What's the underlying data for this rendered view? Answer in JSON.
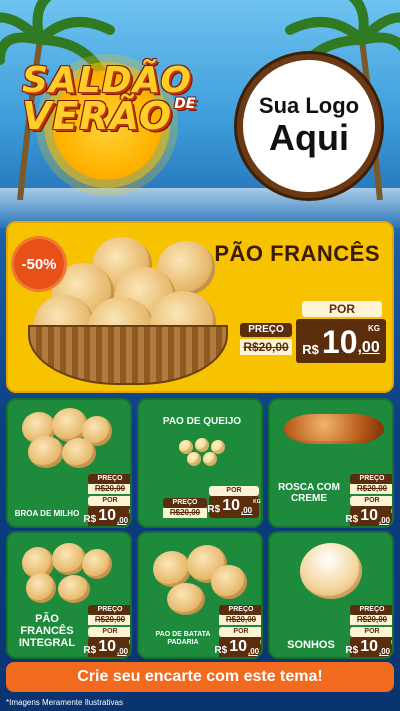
{
  "header": {
    "title_line1": "SALDÃO",
    "title_line2": "VERÃO",
    "title_de": "DE",
    "logo_line1": "Sua Logo",
    "logo_line2": "Aqui"
  },
  "featured": {
    "discount": "-50%",
    "name": "PÃO FRANCÊS",
    "por_label": "POR",
    "preco_label": "PREÇO",
    "old_price": "R$20,00",
    "currency": "R$",
    "price_int": "10",
    "price_dec": ",00",
    "unit": "KG"
  },
  "products": [
    {
      "name": "BROA DE MILHO",
      "preco_label": "PREÇO",
      "old_price": "R$20,00",
      "por_label": "POR",
      "currency": "R$",
      "price_int": "10",
      "price_dec": ",00",
      "unit": "KG"
    },
    {
      "name": "PAO DE QUEIJO",
      "preco_label": "PREÇO",
      "old_price": "R$20,00",
      "por_label": "POR",
      "currency": "R$",
      "price_int": "10",
      "price_dec": ",00",
      "unit": "KG"
    },
    {
      "name": "ROSCA COM CREME",
      "preco_label": "PREÇO",
      "old_price": "R$20,00",
      "por_label": "POR",
      "currency": "R$",
      "price_int": "10",
      "price_dec": ",00",
      "unit": "KG"
    },
    {
      "name": "PÃO FRANCÊS INTEGRAL",
      "preco_label": "PREÇO",
      "old_price": "R$20,00",
      "por_label": "POR",
      "currency": "R$",
      "price_int": "10",
      "price_dec": ",00",
      "unit": "KG"
    },
    {
      "name": "PAO DE BATATA PADARIA",
      "preco_label": "PREÇO",
      "old_price": "R$20,00",
      "por_label": "POR",
      "currency": "R$",
      "price_int": "10",
      "price_dec": ",00",
      "unit": "KG"
    },
    {
      "name": "SONHOS",
      "preco_label": "PREÇO",
      "old_price": "R$20,00",
      "por_label": "POR",
      "currency": "R$",
      "price_int": "10",
      "price_dec": ",00",
      "unit": "KG"
    }
  ],
  "cta": "Crie seu encarte com este tema!",
  "disclaimer": "*Imagens Meramente Ilustrativas",
  "colors": {
    "accent": "#f26a1e",
    "card_green": "#1e8a3c",
    "featured_yellow": "#f7c200",
    "brown": "#5a2e0c"
  }
}
